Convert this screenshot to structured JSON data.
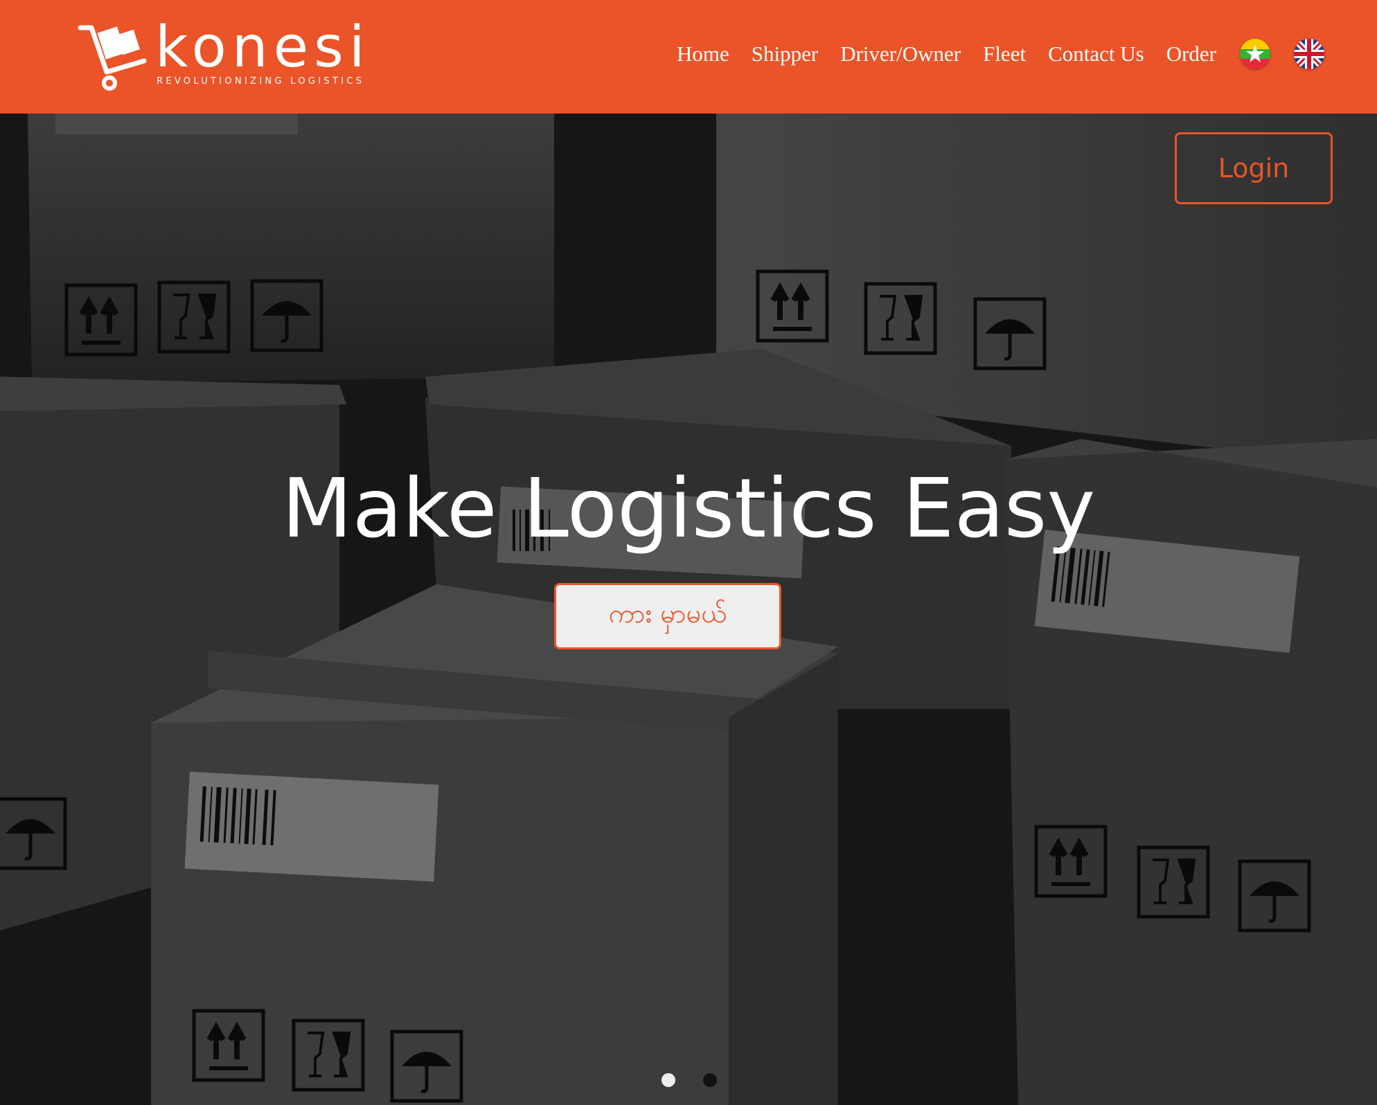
{
  "brand": {
    "name": "konesi",
    "tagline": "REVOLUTIONIZING LOGISTICS"
  },
  "nav": {
    "items": [
      {
        "label": "Home"
      },
      {
        "label": "Shipper"
      },
      {
        "label": "Driver/Owner"
      },
      {
        "label": "Fleet"
      },
      {
        "label": "Contact Us"
      },
      {
        "label": "Order"
      }
    ],
    "languages": [
      "myanmar-flag-icon",
      "uk-flag-icon"
    ]
  },
  "hero": {
    "login_label": "Login",
    "title": "Make Logistics Easy",
    "cta_label": "ကား မှာမယ်",
    "slides": {
      "count": 2,
      "active": 1
    }
  },
  "colors": {
    "accent": "#ea5428",
    "header_bg": "#ea5428",
    "text_light": "#ffffff"
  }
}
